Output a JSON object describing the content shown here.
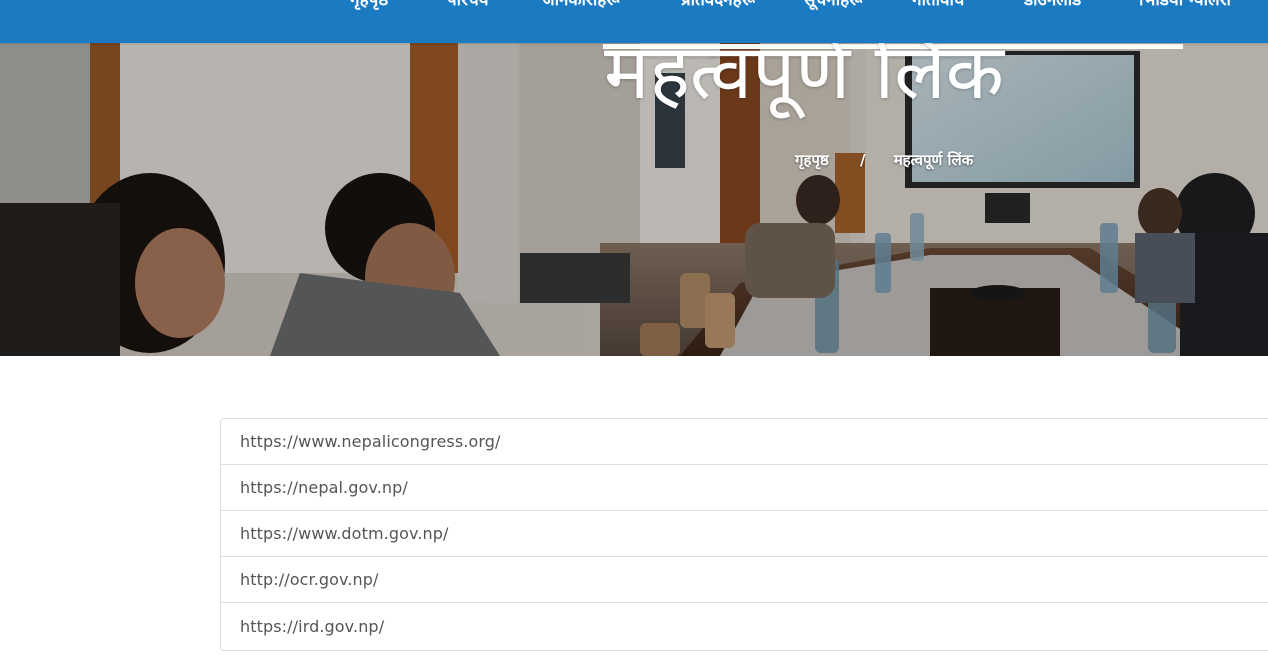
{
  "nav": {
    "items": [
      {
        "label": "गृहपृष्ठ"
      },
      {
        "label": "परिचय"
      },
      {
        "label": "जानकारीहरू"
      },
      {
        "label": "प्रतिवेदनहरू"
      },
      {
        "label": "सूचनाहरू"
      },
      {
        "label": "गतिविधि"
      },
      {
        "label": "डाउनलोड"
      },
      {
        "label": "भिडियो ग्यालेरी"
      }
    ]
  },
  "hero": {
    "title": "महत्वपूर्ण लिंक",
    "breadcrumb": {
      "home": "गृहपृष्ठ",
      "separator": "/",
      "current": "महत्वपूर्ण लिंक"
    }
  },
  "links": [
    {
      "url": "https://www.nepalicongress.org/"
    },
    {
      "url": "https://nepal.gov.np/"
    },
    {
      "url": "https://www.dotm.gov.np/"
    },
    {
      "url": "http://ocr.gov.np/"
    },
    {
      "url": "https://ird.gov.np/"
    }
  ],
  "colors": {
    "nav_background": "#1a7ac2",
    "link_text": "#555555",
    "border": "#dfdfdf"
  }
}
